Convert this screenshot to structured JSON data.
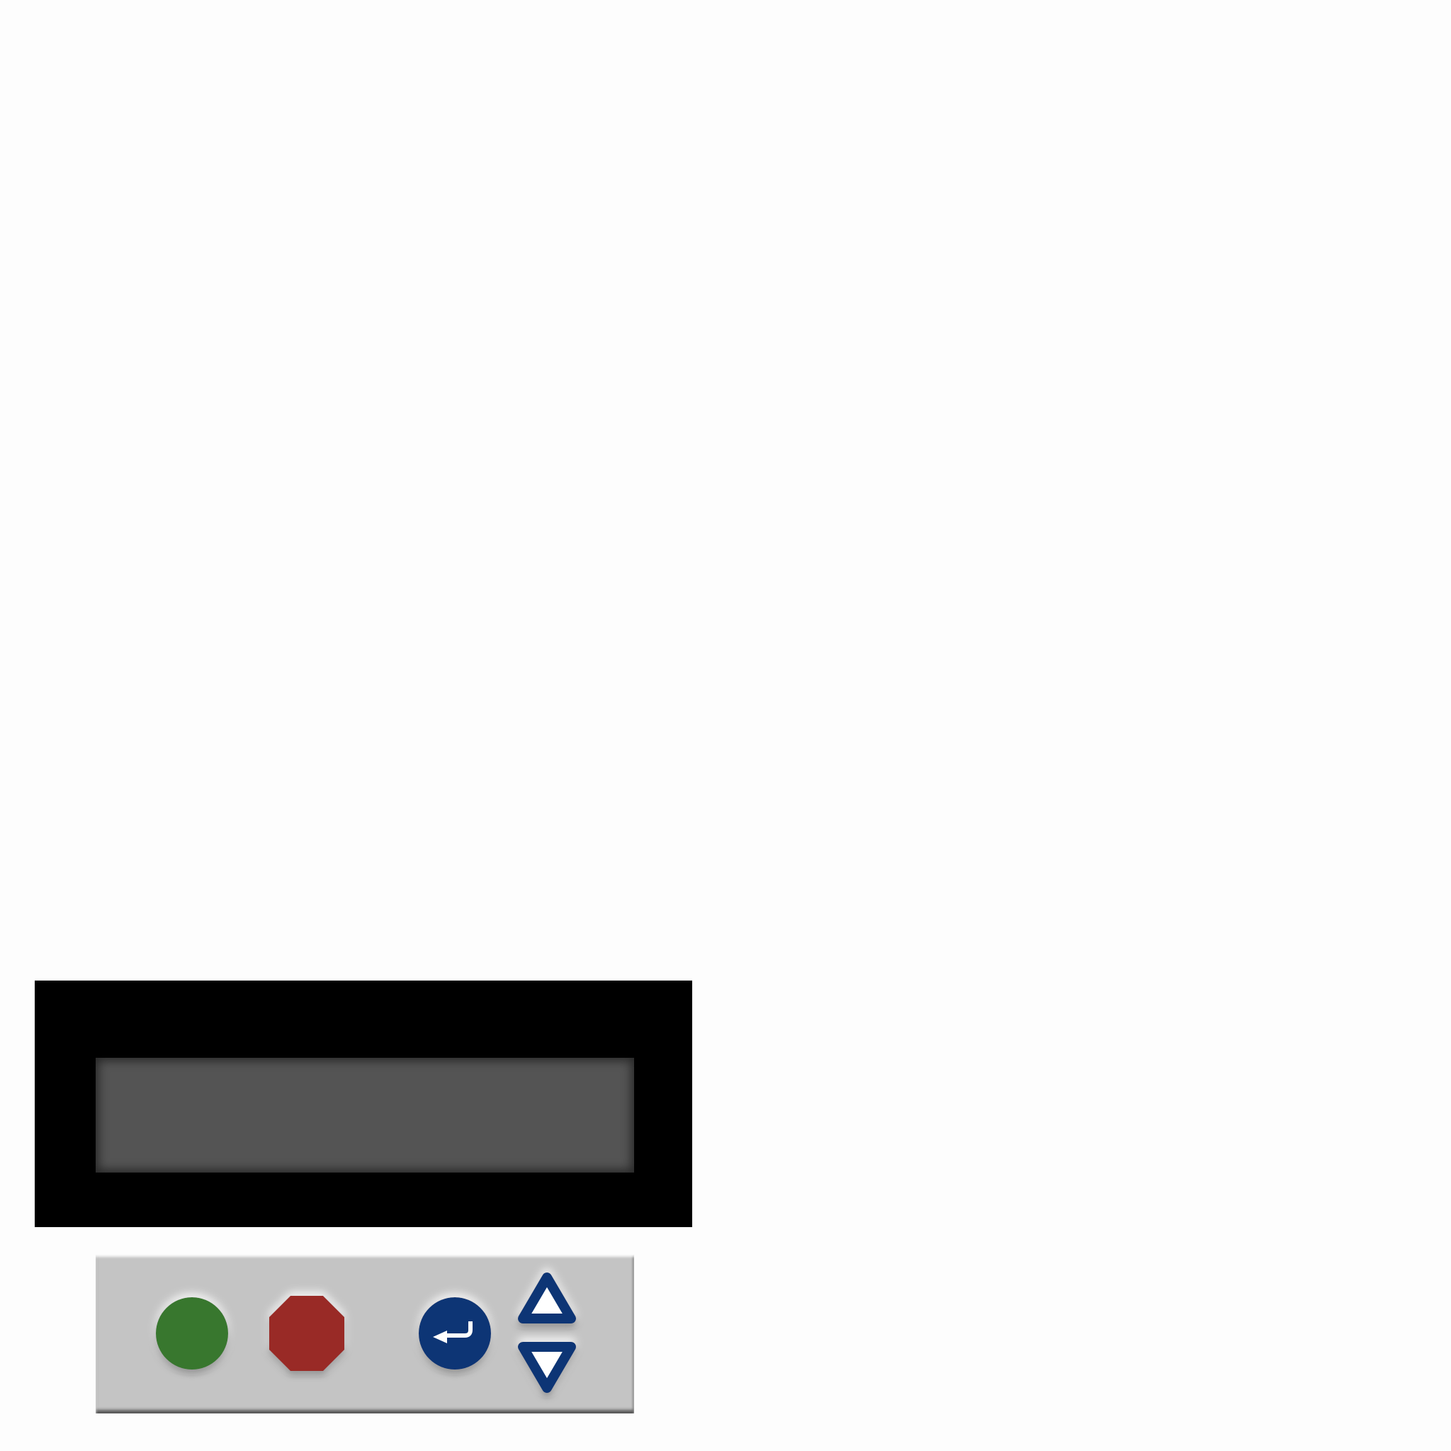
{
  "display": {
    "line1": "",
    "line2": ""
  },
  "keypad": {
    "start": {
      "icon": "start-button-circle",
      "color": "#37772e"
    },
    "stop": {
      "icon": "stop-octagon",
      "color": "#992b26"
    },
    "enter": {
      "icon": "enter-return-arrow-icon",
      "color": "#0a3475"
    },
    "up": {
      "icon": "up-triangle-icon",
      "color": "#0a3475"
    },
    "down": {
      "icon": "down-triangle-icon",
      "color": "#0a3475"
    }
  },
  "colors": {
    "panel": "#c4c4c4",
    "lcd_frame": "#000000",
    "lcd_screen": "#545454"
  }
}
